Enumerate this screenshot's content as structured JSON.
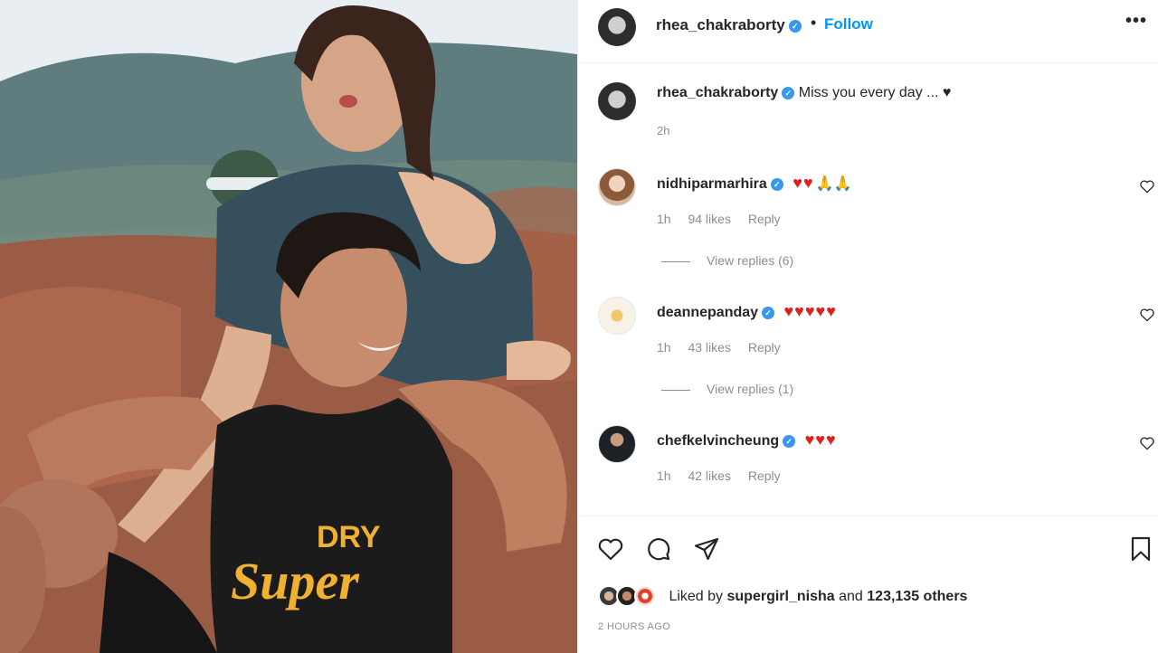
{
  "post": {
    "author": "rhea_chakraborty",
    "follow_label": "Follow",
    "more_label": "•••",
    "separator": "•"
  },
  "caption": {
    "username": "rhea_chakraborty",
    "text": "Miss you every day ... ♥",
    "time": "2h"
  },
  "comments": [
    {
      "username": "nidhiparmarhira",
      "hearts": "♥♥",
      "extra": "🙏🙏",
      "time": "1h",
      "likes": "94 likes",
      "reply": "Reply",
      "view_replies": "View replies (6)"
    },
    {
      "username": "deannepanday",
      "hearts": "♥♥♥♥♥",
      "extra": "",
      "time": "1h",
      "likes": "43 likes",
      "reply": "Reply",
      "view_replies": "View replies (1)"
    },
    {
      "username": "chefkelvincheung",
      "hearts": "♥♥♥",
      "extra": "",
      "time": "1h",
      "likes": "42 likes",
      "reply": "Reply",
      "view_replies": ""
    }
  ],
  "actions": {
    "icons": [
      "heart-icon",
      "comment-icon",
      "share-icon",
      "bookmark-icon"
    ]
  },
  "liked_by": {
    "prefix": "Liked by",
    "user": "supergirl_nisha",
    "conj": "and",
    "others": "123,135 others"
  },
  "posted_ago": "2 HOURS AGO",
  "colors": {
    "link": "#0095f6",
    "verified": "#3897f0",
    "heart_emoji": "#e0201f",
    "muted": "#8e8e8e"
  }
}
